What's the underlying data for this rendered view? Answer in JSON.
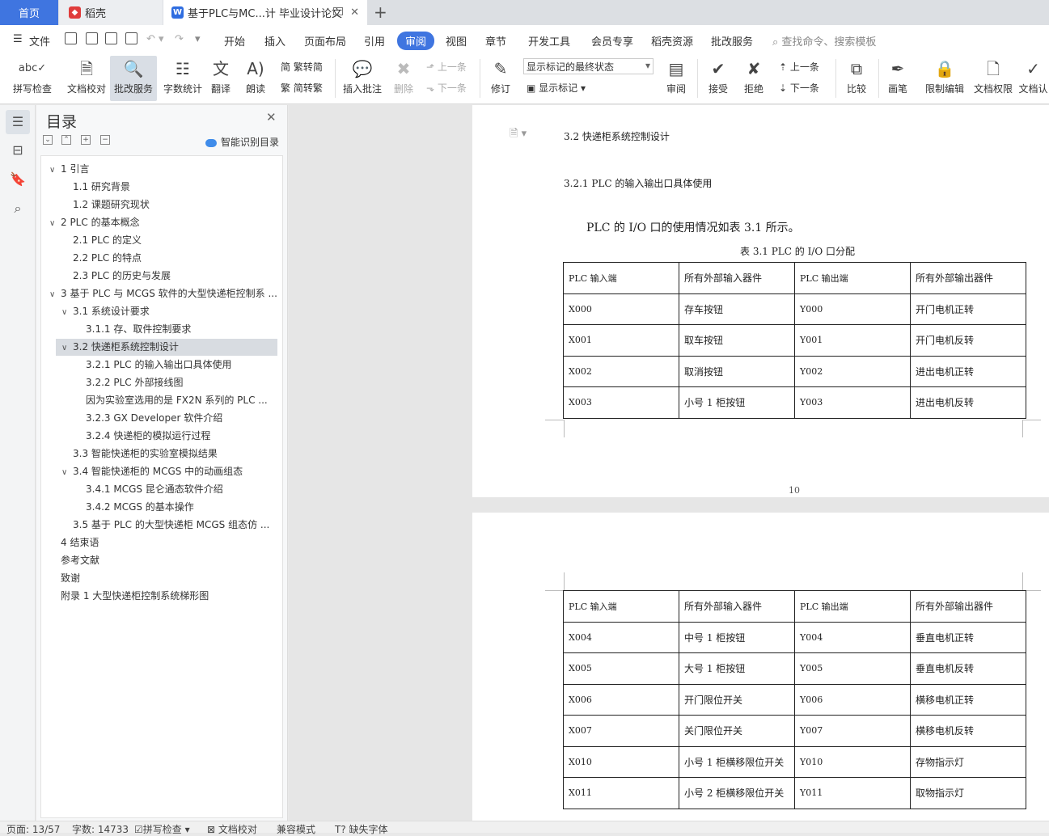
{
  "tabs": {
    "home": "首页",
    "docer": "稻壳",
    "document": "基于PLC与MC...计 毕业设计论文"
  },
  "menu": {
    "file": "文件",
    "items": [
      "开始",
      "插入",
      "页面布局",
      "引用",
      "审阅",
      "视图",
      "章节",
      "开发工具",
      "会员专享",
      "稻壳资源",
      "批改服务"
    ],
    "search_placeholder": "查找命令、搜索模板"
  },
  "ribbon": {
    "spell_check": "拼写检查",
    "doc_proof": "文档校对",
    "correction_service": "批改服务",
    "word_count": "字数统计",
    "translate": "翻译",
    "read_aloud": "朗读",
    "trad_simp": "繁转简",
    "simp_trad": "简转繁",
    "insert_comment": "插入批注",
    "delete": "删除",
    "prev_comment": "上一条",
    "next_comment": "下一条",
    "revise": "修订",
    "final_state": "显示标记的最终状态",
    "show_markup": "显示标记",
    "review_pane": "审阅",
    "accept": "接受",
    "reject": "拒绝",
    "prev_change": "上一条",
    "next_change": "下一条",
    "compare": "比较",
    "pen": "画笔",
    "restrict_edit": "限制编辑",
    "doc_permission": "文档权限",
    "doc_verify": "文档认"
  },
  "toc": {
    "title": "目录",
    "smart_toc": "智能识别目录",
    "items": [
      {
        "label": "1  引言",
        "level": 1,
        "expander": "v"
      },
      {
        "label": "1.1  研究背景",
        "level": 2,
        "expander": ""
      },
      {
        "label": "1.2  课题研究现状",
        "level": 2,
        "expander": ""
      },
      {
        "label": "2 PLC 的基本概念",
        "level": 1,
        "expander": "v"
      },
      {
        "label": "2.1 PLC 的定义",
        "level": 2,
        "expander": ""
      },
      {
        "label": "2.2 PLC 的特点",
        "level": 2,
        "expander": ""
      },
      {
        "label": "2.3 PLC 的历史与发展",
        "level": 2,
        "expander": ""
      },
      {
        "label": "3 基于 PLC 与 MCGS 软件的大型快递柜控制系 ...",
        "level": 1,
        "expander": "v"
      },
      {
        "label": "3.1  系统设计要求",
        "level": 2,
        "expander": "v"
      },
      {
        "label": "3.1.1  存、取件控制要求",
        "level": 3,
        "expander": ""
      },
      {
        "label": "3.2  快递柜系统控制设计",
        "level": 2,
        "expander": "v",
        "selected": true
      },
      {
        "label": "3.2.1 PLC 的输入输出口具体使用",
        "level": 3,
        "expander": ""
      },
      {
        "label": "3.2.2 PLC 外部接线图",
        "level": 3,
        "expander": ""
      },
      {
        "label": "因为实验室选用的是 FX2N 系列的 PLC ...",
        "level": 3,
        "expander": ""
      },
      {
        "label": "3.2.3 GX Developer 软件介绍",
        "level": 3,
        "expander": ""
      },
      {
        "label": "3.2.4  快递柜的模拟运行过程",
        "level": 3,
        "expander": ""
      },
      {
        "label": "3.3  智能快递柜的实验室模拟结果",
        "level": 2,
        "expander": ""
      },
      {
        "label": "3.4  智能快递柜的 MCGS 中的动画组态",
        "level": 2,
        "expander": "v"
      },
      {
        "label": "3.4.1 MCGS 昆仑通态软件介绍",
        "level": 3,
        "expander": ""
      },
      {
        "label": "3.4.2 MCGS 的基本操作",
        "level": 3,
        "expander": ""
      },
      {
        "label": "3.5  基于 PLC 的大型快递柜 MCGS 组态仿 ...",
        "level": 2,
        "expander": ""
      },
      {
        "label": "4  结束语",
        "level": 1,
        "expander": ""
      },
      {
        "label": "参考文献",
        "level": 1,
        "expander": ""
      },
      {
        "label": "致谢",
        "level": 1,
        "expander": ""
      },
      {
        "label": "附录 1 大型快递柜控制系统梯形图",
        "level": 1,
        "expander": ""
      }
    ]
  },
  "document": {
    "header": "3.2  快递柜系统控制设计",
    "subsection": "3.2.1  PLC 的输入输出口具体使用",
    "paragraph": "PLC 的 I/O 口的使用情况如表 3.1 所示。",
    "table_caption": "表 3.1  PLC 的 I/O 口分配",
    "table_header": [
      "PLC 输入端",
      "所有外部输入器件",
      "PLC 输出端",
      "所有外部输出器件"
    ],
    "table1_rows": [
      [
        "X000",
        "存车按钮",
        "Y000",
        "开门电机正转"
      ],
      [
        "X001",
        "取车按钮",
        "Y001",
        "开门电机反转"
      ],
      [
        "X002",
        "取消按钮",
        "Y002",
        "进出电机正转"
      ],
      [
        "X003",
        "小号 1 柜按钮",
        "Y003",
        "进出电机反转"
      ]
    ],
    "page_number": "10",
    "table2_rows": [
      [
        "X004",
        "中号 1 柜按钮",
        "Y004",
        "垂直电机正转"
      ],
      [
        "X005",
        "大号 1 柜按钮",
        "Y005",
        "垂直电机反转"
      ],
      [
        "X006",
        "开门限位开关",
        "Y006",
        "横移电机正转"
      ],
      [
        "X007",
        "关门限位开关",
        "Y007",
        "横移电机反转"
      ],
      [
        "X010",
        "小号 1 柜横移限位开关",
        "Y010",
        "存物指示灯"
      ],
      [
        "X011",
        "小号 2 柜横移限位开关",
        "Y011",
        "取物指示灯"
      ]
    ]
  },
  "status": {
    "page": "页面: 13/57",
    "words": "字数: 14733",
    "spell": "拼写检查",
    "proof": "文档校对",
    "compat": "兼容模式",
    "missing_font": "缺失字体"
  }
}
